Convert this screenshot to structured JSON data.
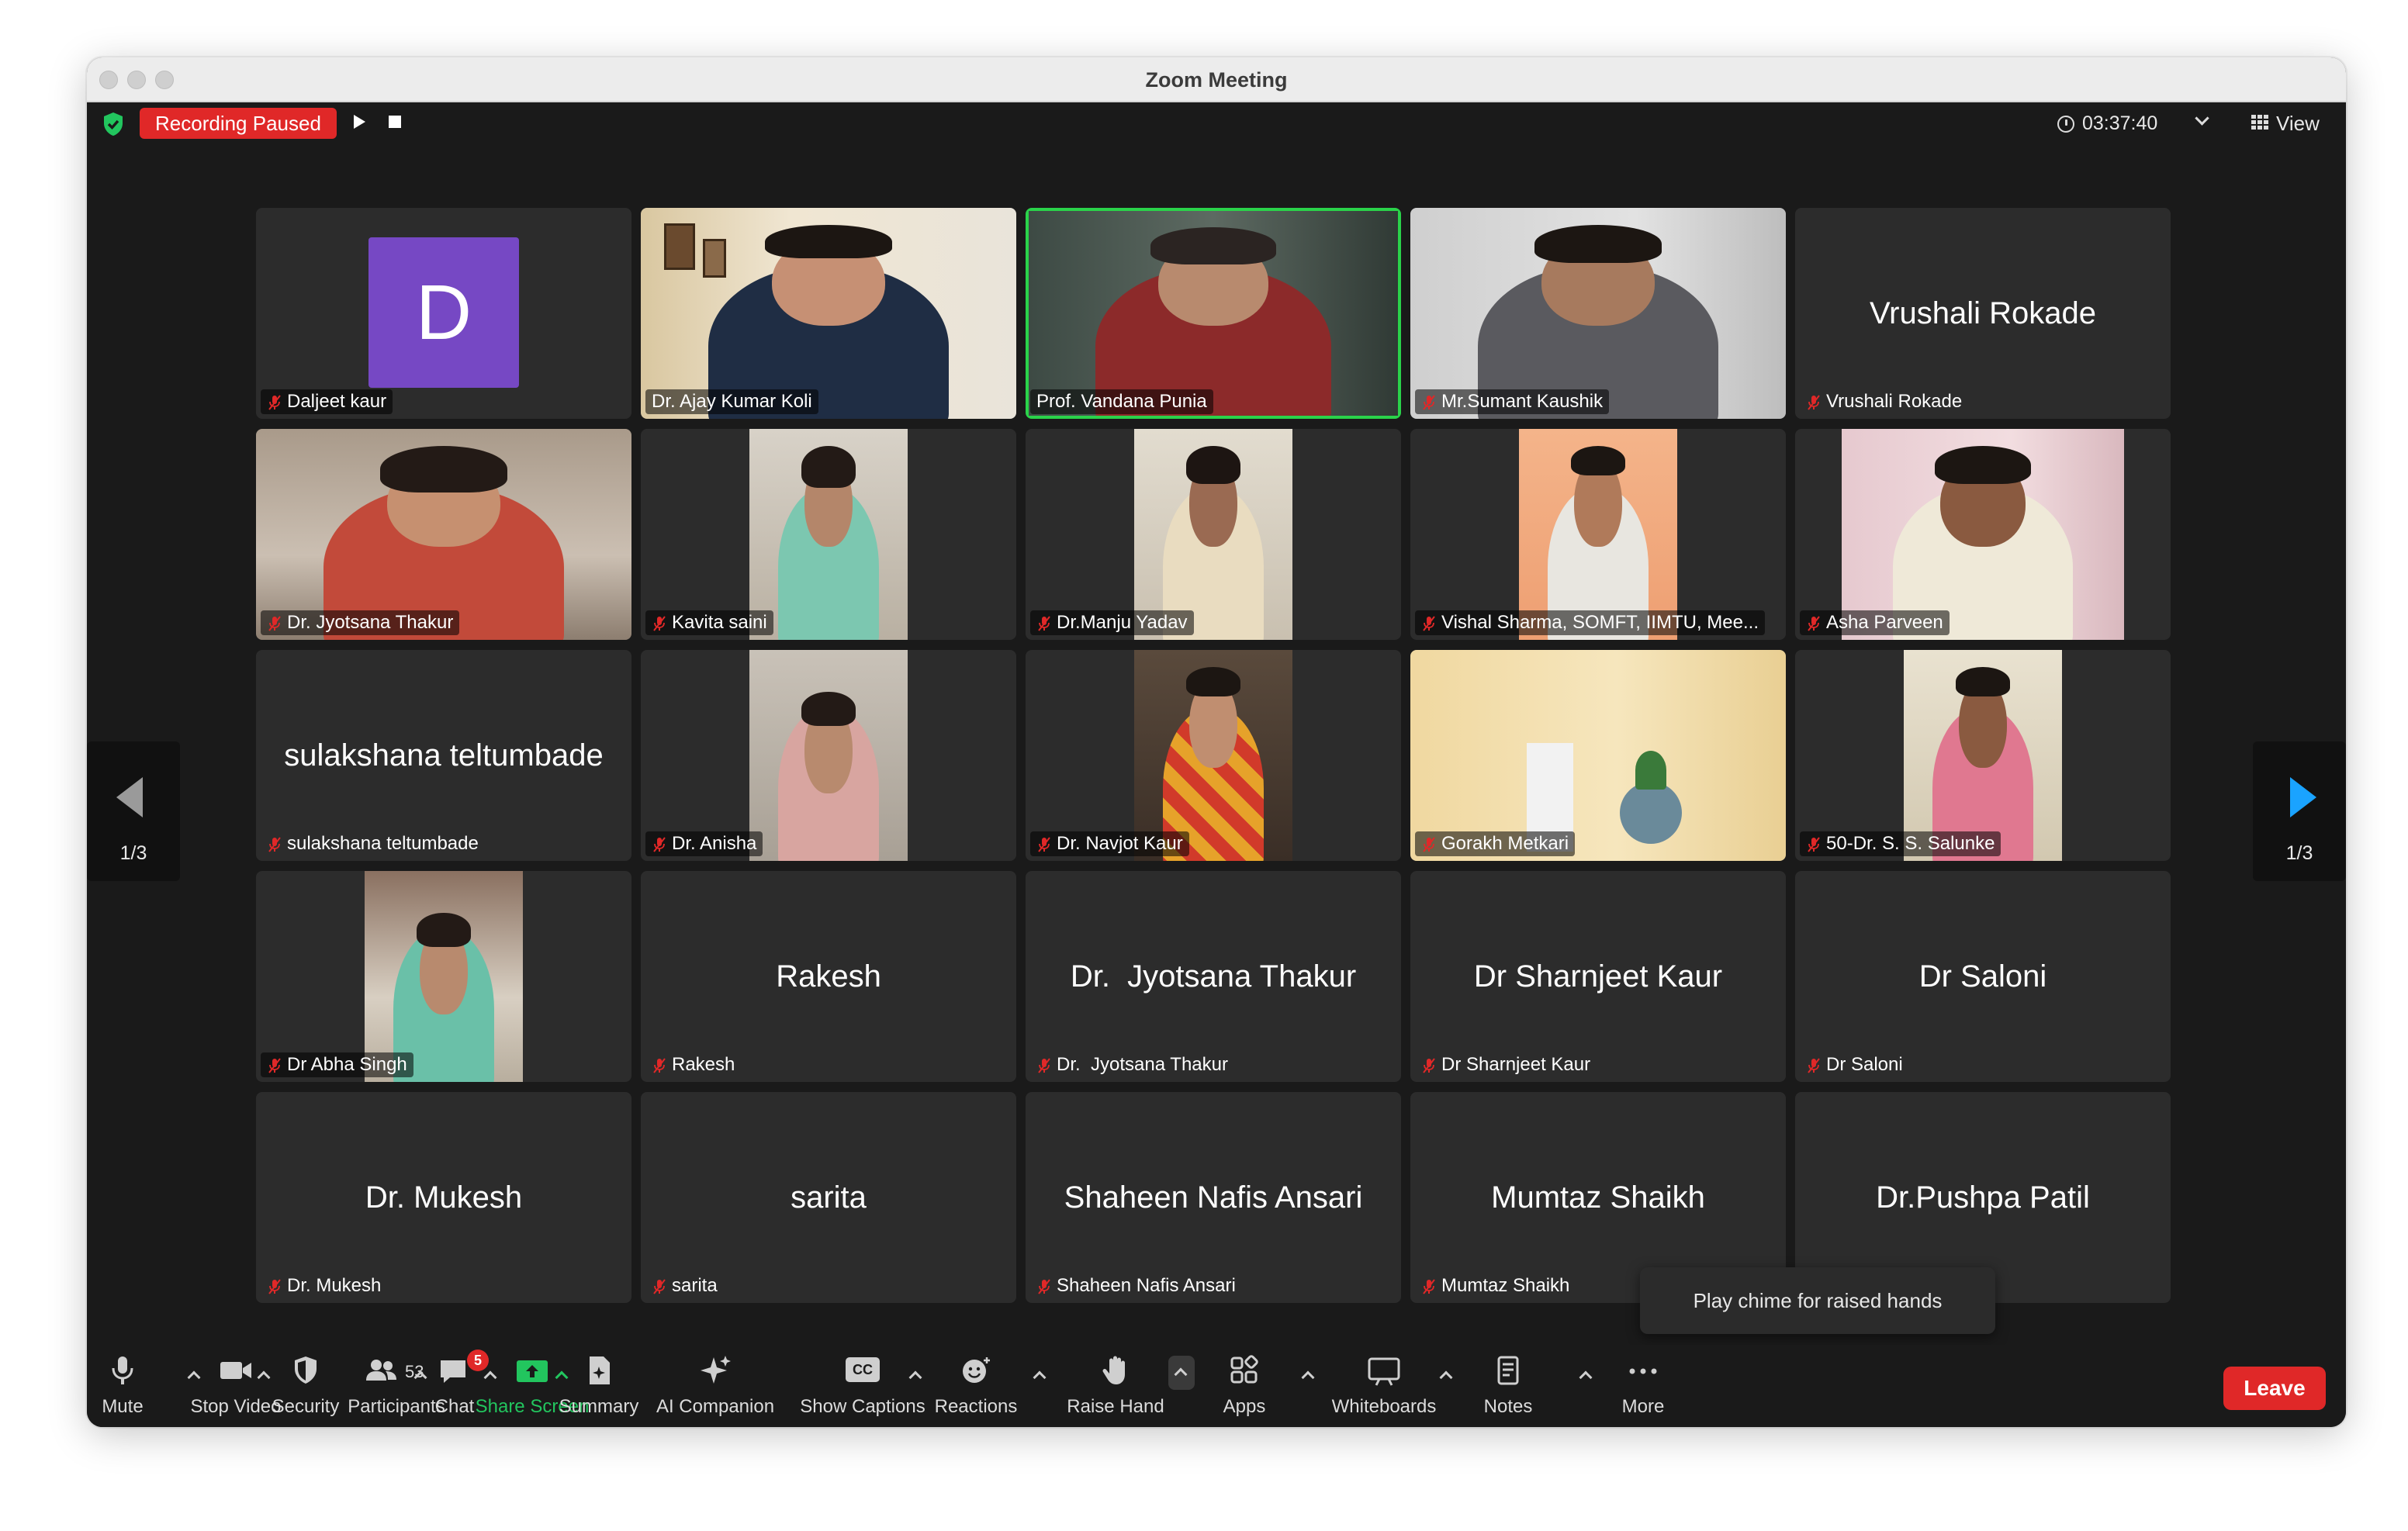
{
  "window": {
    "title": "Zoom Meeting"
  },
  "topbar": {
    "recording_status": "Recording Paused",
    "elapsed_time": "03:37:40",
    "view_label": "View"
  },
  "pager": {
    "left_page": "1/3",
    "right_page": "1/3"
  },
  "colors": {
    "active_speaker": "#2ad34a",
    "record_red": "#e02828",
    "share_green": "#22c55e",
    "mute_red": "#e02828",
    "avatar_purple": "#7648c4"
  },
  "participants": [
    {
      "name": "Daljeet kaur",
      "muted": true,
      "display": "avatar",
      "initial": "D"
    },
    {
      "name": "Dr. Ajay Kumar Koli",
      "muted": false,
      "display": "video"
    },
    {
      "name": "Prof. Vandana Punia",
      "muted": false,
      "display": "video",
      "active_speaker": true
    },
    {
      "name": "Mr.Sumant Kaushik",
      "muted": true,
      "display": "video"
    },
    {
      "name": "Vrushali Rokade",
      "muted": true,
      "display": "name",
      "big_name": "Vrushali Rokade"
    },
    {
      "name": "Dr. Jyotsana Thakur",
      "muted": true,
      "display": "video"
    },
    {
      "name": "Kavita saini",
      "muted": true,
      "display": "video"
    },
    {
      "name": "Dr.Manju Yadav",
      "muted": true,
      "display": "video"
    },
    {
      "name": "Vishal Sharma, SOMFT, IIMTU, Mee...",
      "muted": true,
      "display": "video"
    },
    {
      "name": "Asha Parveen",
      "muted": true,
      "display": "video"
    },
    {
      "name": "sulakshana teltumbade",
      "muted": true,
      "display": "name",
      "big_name": "sulakshana teltumbade"
    },
    {
      "name": "Dr. Anisha",
      "muted": true,
      "display": "video"
    },
    {
      "name": "Dr. Navjot Kaur",
      "muted": true,
      "display": "video"
    },
    {
      "name": "Gorakh Metkari",
      "muted": true,
      "display": "video"
    },
    {
      "name": "50-Dr. S. S. Salunke",
      "muted": true,
      "display": "video"
    },
    {
      "name": "Dr Abha Singh",
      "muted": true,
      "display": "video"
    },
    {
      "name": "Rakesh",
      "muted": true,
      "display": "name",
      "big_name": "Rakesh"
    },
    {
      "name": "Dr.  Jyotsana Thakur",
      "muted": true,
      "display": "name",
      "big_name": "Dr.  Jyotsana Thakur"
    },
    {
      "name": "Dr Sharnjeet Kaur",
      "muted": true,
      "display": "name",
      "big_name": "Dr Sharnjeet Kaur"
    },
    {
      "name": "Dr Saloni",
      "muted": true,
      "display": "name",
      "big_name": "Dr Saloni"
    },
    {
      "name": "Dr. Mukesh",
      "muted": true,
      "display": "name",
      "big_name": "Dr. Mukesh"
    },
    {
      "name": "sarita",
      "muted": true,
      "display": "name",
      "big_name": "sarita"
    },
    {
      "name": "Shaheen Nafis Ansari",
      "muted": true,
      "display": "name",
      "big_name": "Shaheen Nafis Ansari"
    },
    {
      "name": "Mumtaz Shaikh",
      "muted": true,
      "display": "name",
      "big_name": "Mumtaz Shaikh"
    },
    {
      "name": "",
      "muted": false,
      "display": "name",
      "big_name": "Dr.Pushpa Patil"
    }
  ],
  "tooltip": {
    "text": "Play chime for raised hands"
  },
  "toolbar": {
    "mute": "Mute",
    "stop_video": "Stop Video",
    "security": "Security",
    "participants": "Participants",
    "participants_count": "53",
    "chat": "Chat",
    "chat_unread": "5",
    "share_screen": "Share Screen",
    "summary": "Summary",
    "ai_companion": "AI Companion",
    "show_captions": "Show Captions",
    "captions_icon_text": "CC",
    "reactions": "Reactions",
    "raise_hand": "Raise Hand",
    "apps": "Apps",
    "whiteboards": "Whiteboards",
    "notes": "Notes",
    "more": "More",
    "leave": "Leave"
  }
}
